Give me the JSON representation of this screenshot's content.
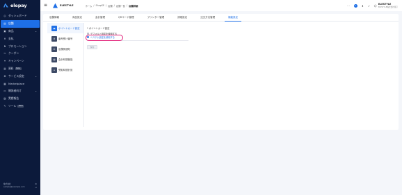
{
  "brand": {
    "name": "elepay",
    "account": "ELESTYLE"
  },
  "sidebar": {
    "items": [
      {
        "icon": "dashboard-icon",
        "glyph": "◎",
        "label": "ダッシュボード",
        "active": false
      },
      {
        "icon": "store-icon",
        "glyph": "▤",
        "label": "店舗",
        "active": true
      },
      {
        "icon": "product-icon",
        "glyph": "▣",
        "label": "商品",
        "active": false,
        "chevron": true
      },
      {
        "icon": "payment-icon",
        "glyph": "¥",
        "label": "支払",
        "active": false
      },
      {
        "icon": "promotion-icon",
        "glyph": "⚑",
        "label": "プロモーション",
        "active": false
      },
      {
        "icon": "coupon-icon",
        "glyph": "✂",
        "label": "クーポン",
        "active": false
      },
      {
        "icon": "campaign-icon",
        "glyph": "✦",
        "label": "キャンペーン",
        "active": false
      },
      {
        "icon": "report-icon",
        "glyph": "▥",
        "label": "資料",
        "badge": "Beta",
        "active": false
      },
      {
        "icon": "service-settings-icon",
        "glyph": "⚙",
        "label": "サービス設定",
        "active": false,
        "chevron": true
      },
      {
        "icon": "marketplace-icon",
        "glyph": "▦",
        "label": "Marketplace",
        "active": false
      },
      {
        "icon": "developer-icon",
        "glyph": "▭",
        "label": "開発者向け",
        "active": false,
        "chevron": true
      },
      {
        "icon": "operation-log-icon",
        "glyph": "▧",
        "label": "実績報告",
        "active": false
      },
      {
        "icon": "tools-icon",
        "glyph": "✎",
        "label": "ツール",
        "badge": "Beta",
        "active": false
      }
    ],
    "footer": {
      "line1": "株式会社",
      "line2": "sample@example.com"
    }
  },
  "header": {
    "brand_name": "ELESTYLE",
    "breadcrumbs": [
      "ホーム",
      "/",
      "ShopSE",
      "/",
      "店舗",
      "/",
      "店舗一覧",
      "/"
    ],
    "breadcrumb_current": "店舗詳細",
    "account_name": "ELESTYLE",
    "account_sub": "ELESTYLE株式会社東京"
  },
  "tabs": [
    {
      "label": "店舗情報",
      "active": false
    },
    {
      "label": "商品設定",
      "active": false
    },
    {
      "label": "会計管理",
      "active": false
    },
    {
      "label": "QRコード管理",
      "active": false
    },
    {
      "label": "プリンター管理",
      "active": false
    },
    {
      "label": "詳細設定",
      "active": false
    },
    {
      "label": "注文方法管理",
      "active": false
    },
    {
      "label": "機能設定",
      "active": true
    }
  ],
  "subnav": [
    {
      "icon": "point-card-icon",
      "glyph": "▣",
      "label": "ポイントカード設定",
      "active": true
    },
    {
      "icon": "reception-number-icon",
      "glyph": "#",
      "label": "番号受け番号",
      "active": false
    },
    {
      "icon": "notification-icon",
      "glyph": "✉",
      "label": "店舗側通知",
      "active": false
    },
    {
      "icon": "cashier-icon",
      "glyph": "▤",
      "label": "会計時間機能",
      "active": false
    },
    {
      "icon": "pickup-icon",
      "glyph": "⌂",
      "label": "受取時間計設",
      "active": false
    }
  ],
  "form": {
    "label": "* ポイントカード設定",
    "options": [
      {
        "label": "デフォルト設定を使用する",
        "selected": false
      },
      {
        "label": "システム設定を使用する",
        "selected": true
      }
    ],
    "save_label": "保存"
  },
  "colors": {
    "accent": "#1e6fe6",
    "sidebar_bg": "#0c1a3b",
    "highlight_ring": "#e2227a"
  }
}
